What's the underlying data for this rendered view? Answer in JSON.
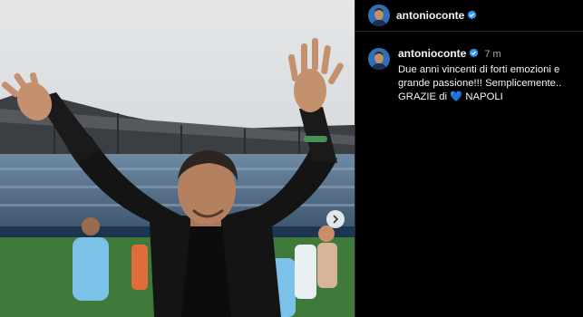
{
  "post": {
    "image_alt": "Antonio Conte waving to fans in a stadium",
    "next_button": "chevron-right"
  },
  "header": {
    "username": "antonioconte",
    "verified": true
  },
  "caption": {
    "username": "antonioconte",
    "time": "7 m",
    "line1": "Due anni vincenti di forti emozioni e grande passione!!! Semplicemente..",
    "line2_prefix": "GRAZIE di",
    "heart": "💙",
    "line2_suffix": "NAPOLI"
  },
  "colors": {
    "verified_badge": "#3897f0",
    "panel_bg": "#000000",
    "text": "#f5f5f5",
    "muted": "#a8a8a8"
  }
}
